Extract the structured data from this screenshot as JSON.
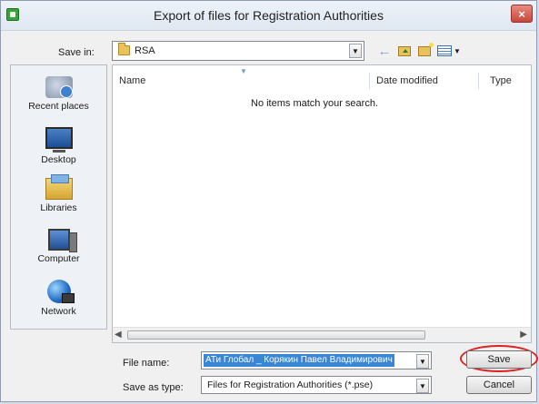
{
  "window": {
    "title": "Export of files for Registration Authorities",
    "close_label": "×"
  },
  "save_in": {
    "label": "Save in:",
    "value": "RSA"
  },
  "toolbar": {
    "back_glyph": "←"
  },
  "places": [
    {
      "label": "Recent places",
      "icon": "recent-places-icon"
    },
    {
      "label": "Desktop",
      "icon": "desktop-icon"
    },
    {
      "label": "Libraries",
      "icon": "libraries-icon"
    },
    {
      "label": "Computer",
      "icon": "computer-icon"
    },
    {
      "label": "Network",
      "icon": "network-icon"
    }
  ],
  "file_list": {
    "columns": [
      "Name",
      "Date modified",
      "Type"
    ],
    "empty_message": "No items match your search."
  },
  "file_name": {
    "label": "File name:",
    "value": "АТи Глобал _ Корякин Павел Владимирович"
  },
  "save_as_type": {
    "label": "Save as type:",
    "value": "Files for Registration Authorities (*.pse)"
  },
  "buttons": {
    "save": "Save",
    "cancel": "Cancel"
  },
  "colors": {
    "highlight": "#e02020",
    "selection": "#3a86d6"
  }
}
